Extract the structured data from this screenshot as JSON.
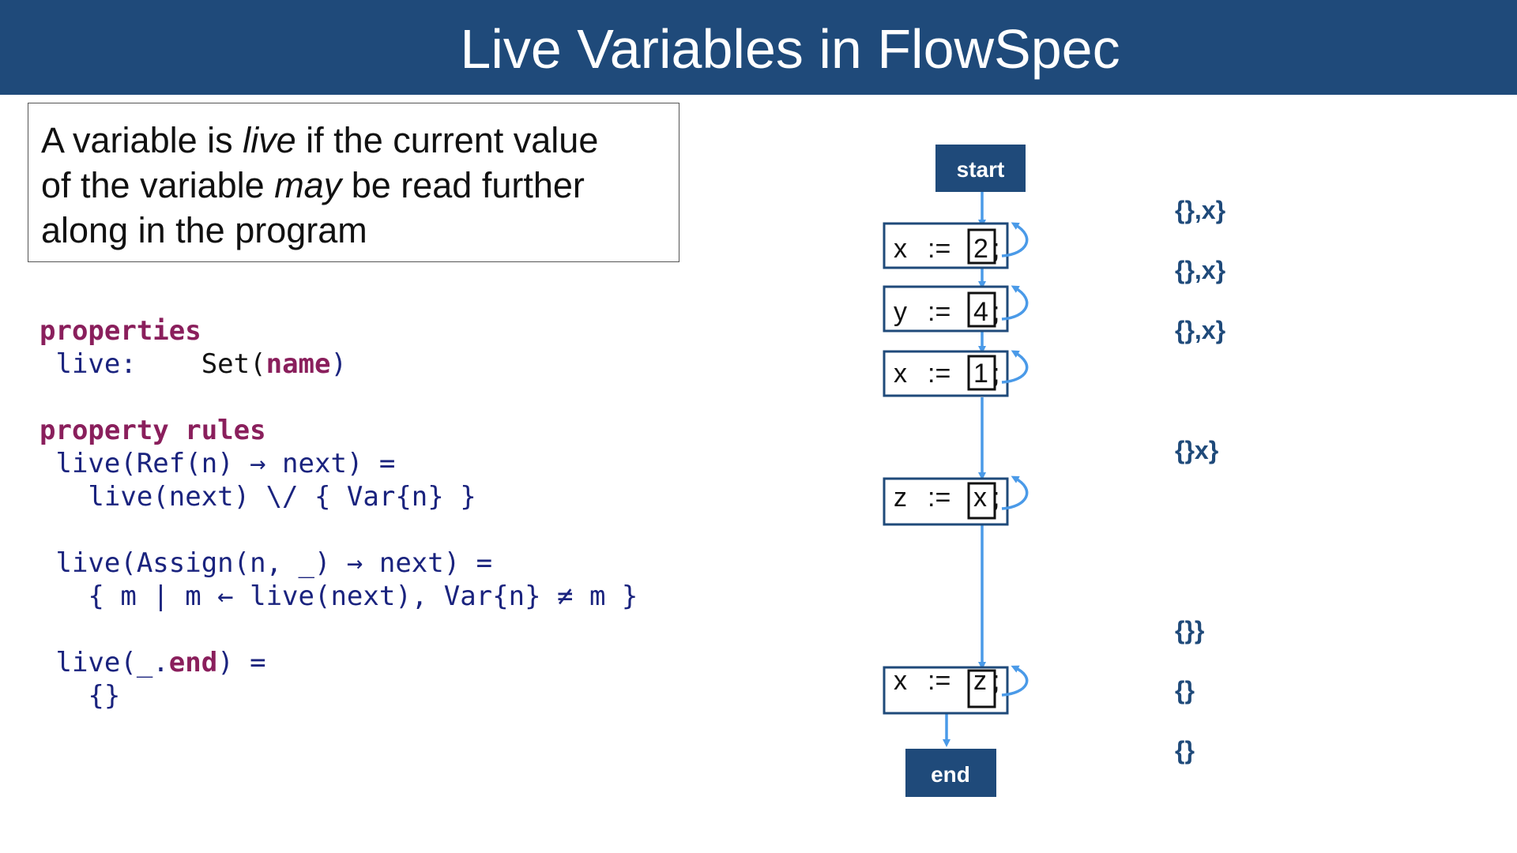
{
  "title": "Live Variables in FlowSpec",
  "definition": {
    "line1_pre": "A variable is ",
    "line1_em": "live",
    "line1_post": " if the current value",
    "line2_pre": "of the variable ",
    "line2_em": "may",
    "line2_post": " be read further",
    "line3": "along in the program"
  },
  "code": {
    "properties_kw": "properties",
    "live_decl": " live:    ",
    "set_type": "Set(",
    "name_kw": "name",
    "close_paren": ")",
    "property_rules_kw": "property rules",
    "rule1_line1": " live(Ref(n) → next) =",
    "rule1_line2": "   live(next) \\/ { Var{n} }",
    "rule2_line1": " live(Assign(n, _) → next) =",
    "rule2_line2": "   { m | m ← live(next), Var{n} ≠ m }",
    "rule3_prefix": " live(_.",
    "end_kw": "end",
    "rule3_suffix": ") =",
    "rule3_line2": "   {}"
  },
  "diagram": {
    "start_label": "start",
    "end_label": "end",
    "nodes": [
      {
        "lhs": "x",
        "op": ":=",
        "rhs": "2",
        "semi": ";"
      },
      {
        "lhs": "y",
        "op": ":=",
        "rhs": "4",
        "semi": ";"
      },
      {
        "lhs": "x",
        "op": ":=",
        "rhs": "1",
        "semi": ";"
      },
      {
        "lhs": "z",
        "op": ":=",
        "rhs": "x",
        "semi": ";"
      },
      {
        "lhs": "x",
        "op": ":=",
        "rhs": "z",
        "semi": ";"
      }
    ],
    "live_sets": [
      "{},x}",
      "{},x}",
      "{},x}",
      "{}x}",
      "{}}",
      "{}",
      "{}"
    ],
    "colors": {
      "node_border": "#1f4a7a",
      "edge": "#4a9ae8",
      "terminal_fill": "#1f4a7a",
      "set_text": "#1f4a7a"
    }
  }
}
